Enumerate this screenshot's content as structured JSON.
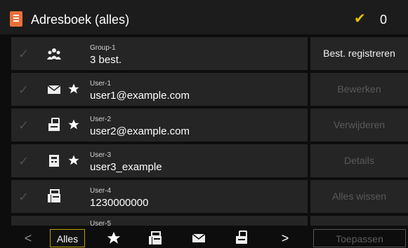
{
  "header": {
    "title": "Adresboek (alles)",
    "selected_count": "0"
  },
  "rows": [
    {
      "type_icon": "group-icon",
      "starred": false,
      "small": "Group-1",
      "big": "3 best."
    },
    {
      "type_icon": "email-icon",
      "starred": true,
      "small": "User-1",
      "big": "user1@example.com"
    },
    {
      "type_icon": "network-folder-icon",
      "starred": true,
      "small": "User-2",
      "big": "user2@example.com"
    },
    {
      "type_icon": "ifax-icon",
      "starred": true,
      "small": "User-3",
      "big": "user3_example"
    },
    {
      "type_icon": "fax-icon",
      "starred": false,
      "small": "User-4",
      "big": "1230000000"
    },
    {
      "type_icon": "",
      "starred": false,
      "small": "User-5",
      "big": ""
    }
  ],
  "side_buttons": [
    {
      "label": "Best. registreren",
      "enabled": true
    },
    {
      "label": "Bewerken",
      "enabled": false
    },
    {
      "label": "Verwijderen",
      "enabled": false
    },
    {
      "label": "Details",
      "enabled": false
    },
    {
      "label": "Alles wissen",
      "enabled": false
    }
  ],
  "bottom": {
    "prev": "<",
    "all_label": "Alles",
    "filters": [
      "star-icon",
      "fax-icon",
      "email-icon",
      "network-folder-icon"
    ],
    "next": ">",
    "apply_label": "Toepassen"
  },
  "colors": {
    "accent": "#e7c000",
    "app_icon": "#e8703a",
    "row_bg": "#252525",
    "disabled_text": "#5a5a5a"
  }
}
